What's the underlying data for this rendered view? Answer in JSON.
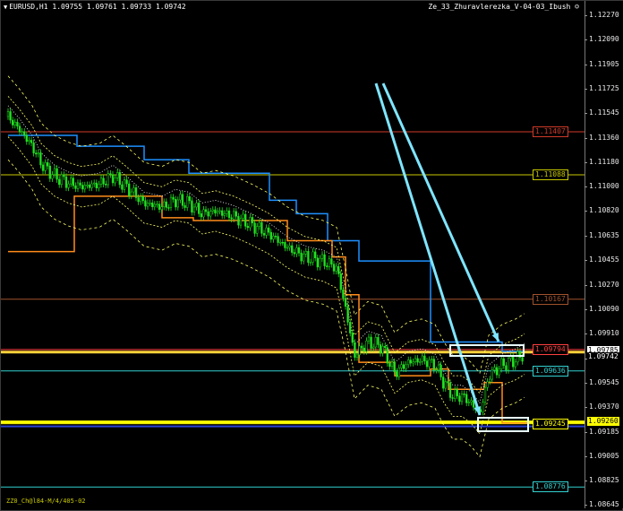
{
  "window": {
    "symbol_title": "EURUSD,H1  1.09755 1.09761 1.09733 1.09742",
    "indicator_name": "Ze_33_Zhuravlerezka_V-04-03_Ibush",
    "footer_note": "ZZ0_Ch@l84-M/4/405-02"
  },
  "axis": {
    "ticks": [
      "1.12270",
      "1.12090",
      "1.11905",
      "1.11725",
      "1.11545",
      "1.11360",
      "1.11180",
      "1.11000",
      "1.10820",
      "1.10635",
      "1.10455",
      "1.10270",
      "1.10090",
      "1.09910",
      "1.09725",
      "1.09545",
      "1.09370",
      "1.09185",
      "1.09005",
      "1.08825",
      "1.08645"
    ],
    "badges": [
      {
        "text": "1.09785",
        "bg": "#ffffff"
      },
      {
        "text": "1.09742",
        "bg": "#000000",
        "fg": "#ffffff"
      },
      {
        "text": "1.09260",
        "bg": "#ffff00"
      }
    ]
  },
  "levels": [
    {
      "price": "1.11407",
      "color": "#d03a2a"
    },
    {
      "price": "1.11088",
      "color": "#c8c800"
    },
    {
      "price": "1.10167",
      "color": "#a0522d"
    },
    {
      "price": "1.09794",
      "color": "#ff4040"
    },
    {
      "price": "1.09636",
      "color": "#33d0d0"
    },
    {
      "price": "1.09245",
      "color": "#ffff00"
    },
    {
      "price": "1.08776",
      "color": "#33d0d0"
    }
  ],
  "colors": {
    "candles": "#22e222",
    "upper_channel": "#1e90ff",
    "lower_channel": "#ff8c1a",
    "arrows": "#7fe5ff",
    "bands": "#ffff66",
    "envelope": "#ffffff"
  }
}
